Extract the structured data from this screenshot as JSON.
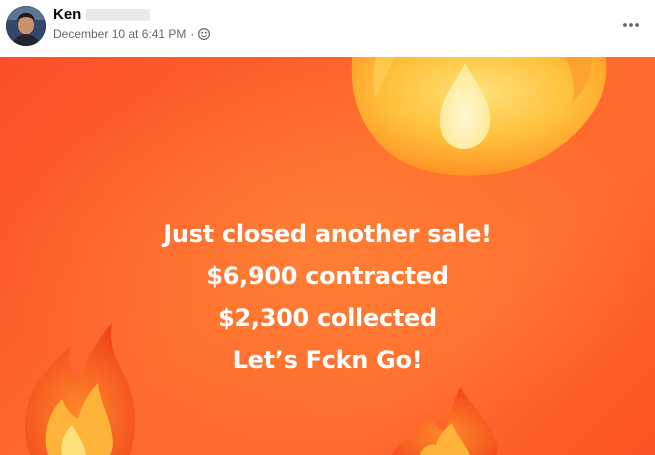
{
  "post": {
    "author_name": "Ken",
    "timestamp": "December 10 at 6:41 PM",
    "meta_separator": "·",
    "audience_icon": "friends-globe-icon",
    "more_icon": "more-options-icon"
  },
  "image": {
    "lines": [
      "Just closed another sale!",
      "$6,900 contracted",
      "$2,300 collected",
      "Let’s Fckn Go!"
    ],
    "background_color": "#fe5f2b",
    "text_color": "#ffffff",
    "decorations": [
      "fire-emoji-top-right",
      "fire-emoji-bottom-left",
      "fire-emoji-bottom-center"
    ]
  }
}
